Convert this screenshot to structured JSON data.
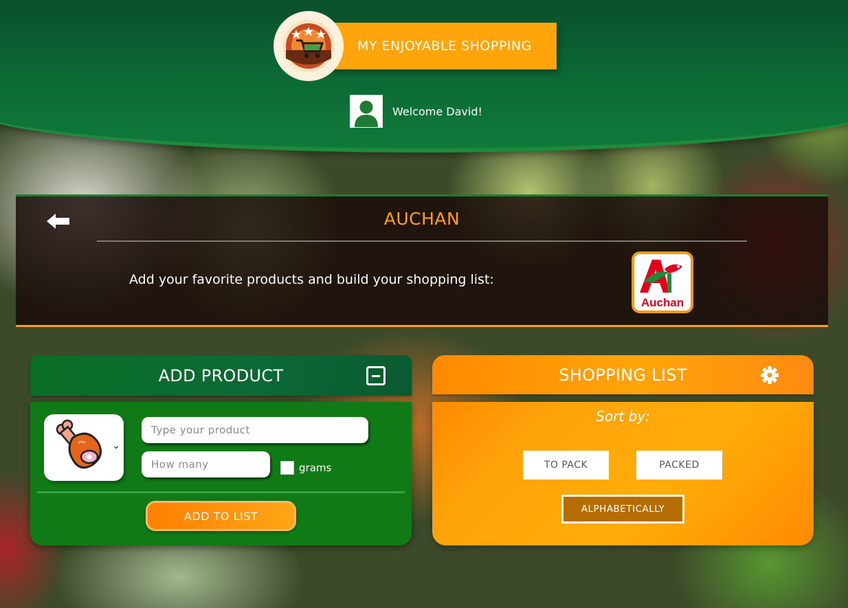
{
  "header": {
    "app_title": "MY ENJOYABLE SHOPPING",
    "welcome_text": "Welcome David!"
  },
  "store": {
    "name": "AUCHAN",
    "subtitle": "Add your favorite products and build your shopping list:",
    "logo_text": "Auchan"
  },
  "add_product": {
    "title": "ADD PRODUCT",
    "product_placeholder": "Type your product",
    "quantity_placeholder": "How many",
    "grams_label": "grams",
    "grams_checked": false,
    "add_button_label": "ADD TO LIST",
    "selected_icon": "meat-icon"
  },
  "shopping_list": {
    "title": "SHOPPING LIST",
    "sort_label": "Sort by:",
    "sort_options": [
      "TO PACK",
      "PACKED",
      "ALPHABETICALLY"
    ],
    "active_sort": "ALPHABETICALLY"
  },
  "colors": {
    "accent_orange": "#ffa40a",
    "brand_green": "#0c6a34",
    "store_title": "#ff9f1c",
    "active_sort_bg": "#b56d00"
  }
}
